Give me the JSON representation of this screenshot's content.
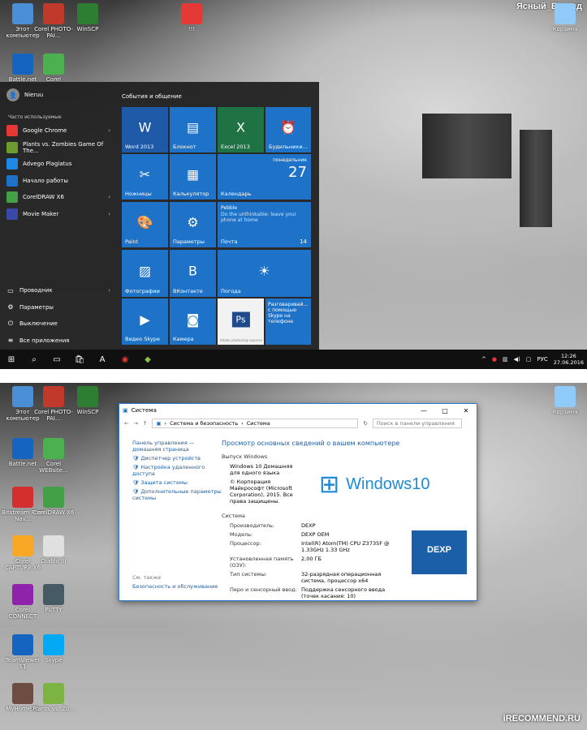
{
  "watermark": "Ясный_Взгляд",
  "shot1": {
    "desktop_icons": [
      {
        "label": "Этот компьютер",
        "color": "#4a8fd6"
      },
      {
        "label": "Corel PHOTO-PAI...",
        "color": "#c0392b"
      },
      {
        "label": "WinSCP",
        "color": "#2e7d32"
      },
      {
        "label": "!!!",
        "color": "#e53935"
      },
      {
        "label": "Корзина",
        "color": "#90caf9"
      },
      {
        "label": "Battle.net",
        "color": "#1565c0"
      },
      {
        "label": "Corel",
        "color": "#4caf50"
      }
    ],
    "start": {
      "user": "Nieruu",
      "frequent_label": "Часто используемые",
      "apps": [
        {
          "label": "Google Chrome",
          "color": "#e53935",
          "arrow": "›"
        },
        {
          "label": "Plants vs. Zombies Game Of The...",
          "color": "#6d9b2f",
          "arrow": ""
        },
        {
          "label": "Advego Plagiatus",
          "color": "#1e88e5",
          "arrow": ""
        },
        {
          "label": "Начало работы",
          "color": "#1e73c8",
          "arrow": ""
        },
        {
          "label": "CorelDRAW X6",
          "color": "#43a047",
          "arrow": "›"
        },
        {
          "label": "Movie Maker",
          "color": "#3949ab",
          "arrow": "›"
        }
      ],
      "bottom": [
        {
          "label": "Проводник",
          "icon": "▭",
          "arrow": "›"
        },
        {
          "label": "Параметры",
          "icon": "⚙",
          "arrow": ""
        },
        {
          "label": "Выключение",
          "icon": "⏻",
          "arrow": ""
        },
        {
          "label": "Все приложения",
          "icon": "≡",
          "arrow": ""
        }
      ],
      "tiles_heading": "События и общение",
      "tiles": [
        {
          "label": "Word 2013",
          "glyph": "W",
          "color": "#1e5aa8"
        },
        {
          "label": "Блокнот",
          "glyph": "▤",
          "color": "#1e73c8"
        },
        {
          "label": "Excel 2013",
          "glyph": "X",
          "color": "#1f7244"
        },
        {
          "label": "Будильники...",
          "glyph": "⏰",
          "color": "#1e73c8"
        },
        {
          "label": "Ножницы",
          "glyph": "✂",
          "color": "#1e73c8"
        },
        {
          "label": "Калькулятор",
          "glyph": "▦",
          "color": "#1e73c8"
        },
        {
          "label": "Календарь",
          "glyph": "",
          "color": "#1e73c8",
          "weekday": "понедельник",
          "day": "27"
        },
        {
          "label": "Paint",
          "glyph": "🎨",
          "color": "#1e73c8"
        },
        {
          "label": "Параметры",
          "glyph": "⚙",
          "color": "#1e73c8"
        },
        {
          "label": "Почта",
          "glyph": "",
          "color": "#1e73c8",
          "sender": "Pebble",
          "preview": "Do the unthinkable: leave your phone at home",
          "count": "14"
        },
        {
          "label": "Фотографии",
          "glyph": "▨",
          "color": "#1e73c8"
        },
        {
          "label": "ВКонтакте",
          "glyph": "B",
          "color": "#1e73c8"
        },
        {
          "label": "Погода",
          "glyph": "☀",
          "color": "#1e73c8"
        },
        {
          "label": "Видео Skype",
          "glyph": "▶",
          "color": "#1e73c8"
        },
        {
          "label": "Камера",
          "glyph": "◙",
          "color": "#1e73c8"
        },
        {
          "label": "",
          "glyph": "Ps",
          "color": "#f2f2f2",
          "sub": "Adobe photoshop express"
        },
        {
          "label": "",
          "glyph": "",
          "color": "#1e73c8",
          "text": "Разговаривай... с помощью Skype на телефоне"
        }
      ]
    },
    "taskbar": {
      "lang": "РУС",
      "time": "12:26",
      "date": "27.06.2016"
    }
  },
  "shot2": {
    "desktop_icons": [
      {
        "label": "Этот компьютер",
        "color": "#4a8fd6"
      },
      {
        "label": "Corel PHOTO-PAI...",
        "color": "#c0392b"
      },
      {
        "label": "WinSCP",
        "color": "#2e7d32"
      },
      {
        "label": "Battle.net",
        "color": "#1565c0"
      },
      {
        "label": "Corel WEBsite...",
        "color": "#4caf50"
      },
      {
        "label": "Bitstream Font Nav...",
        "color": "#d32f2f"
      },
      {
        "label": "CorelDRAW X6",
        "color": "#43a047"
      },
      {
        "label": "Corel CAPTURE X6",
        "color": "#f9a825"
      },
      {
        "label": "Diablo III",
        "color": "#e0e0e0"
      },
      {
        "label": "Corel CONNECT",
        "color": "#8e24aa"
      },
      {
        "label": "PuTTY",
        "color": "#455a64"
      },
      {
        "label": "TeamViewer 11",
        "color": "#1565c0"
      },
      {
        "label": "Skype",
        "color": "#03a9f4"
      },
      {
        "label": "MyHome.lib",
        "color": "#6d4c41"
      },
      {
        "label": "Plants vs. Zo...",
        "color": "#7cb342"
      },
      {
        "label": "Корзина",
        "color": "#90caf9"
      }
    ],
    "window": {
      "title": "Система",
      "breadcrumb": [
        "Система и безопасность",
        "Система"
      ],
      "search_placeholder": "Поиск в панели управления",
      "side_links": [
        "Панель управления — домашняя страница",
        "Диспетчер устройств",
        "Настройка удаленного доступа",
        "Защита системы",
        "Дополнительные параметры системы"
      ],
      "see_also": "См. также",
      "see_also_link": "Безопасность и обслуживание",
      "heading": "Просмотр основных сведений о вашем компьютере",
      "edition_section": "Выпуск Windows",
      "edition": "Windows 10 Домашняя для одного языка",
      "copyright": "© Корпорация Майкрософт (Microsoft Corporation), 2015. Все права защищены.",
      "logo_text": "Windows10",
      "system_section": "Система",
      "rows": [
        {
          "k": "Производитель:",
          "v": "DEXP"
        },
        {
          "k": "Модель:",
          "v": "DEXP OEM"
        },
        {
          "k": "Процессор:",
          "v": "Intel(R) Atom(TM) CPU Z3735F @ 1.33GHz 1.33 GHz"
        },
        {
          "k": "Установленная память (ОЗУ):",
          "v": "2,00 ГБ"
        },
        {
          "k": "Тип системы:",
          "v": "32-разрядная операционная система, процессор x64"
        },
        {
          "k": "Перо и сенсорный ввод:",
          "v": "Поддержка сенсорного ввода (точек касания: 10)"
        }
      ],
      "oem_logo": "DEXP"
    },
    "site_mark": "iRECOMMEND.RU"
  }
}
